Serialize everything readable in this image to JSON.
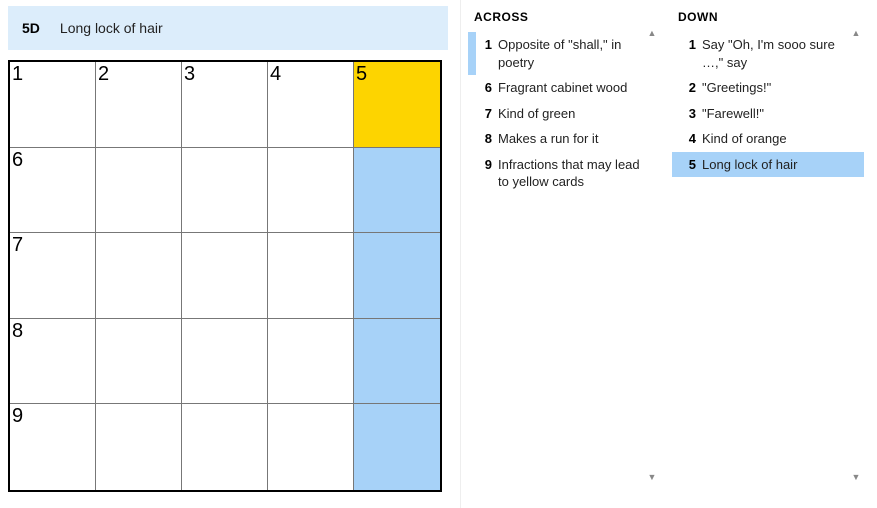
{
  "current_clue": {
    "label": "5D",
    "text": "Long lock of hair"
  },
  "grid": {
    "rows": 5,
    "cols": 5,
    "cells": [
      {
        "n": "1"
      },
      {
        "n": "2"
      },
      {
        "n": "3"
      },
      {
        "n": "4"
      },
      {
        "n": "5",
        "focus": true,
        "hl": true
      },
      {
        "n": "6"
      },
      {},
      {},
      {},
      {
        "hl": true
      },
      {
        "n": "7"
      },
      {},
      {},
      {},
      {
        "hl": true
      },
      {
        "n": "8"
      },
      {},
      {},
      {},
      {
        "hl": true
      },
      {
        "n": "9"
      },
      {},
      {},
      {},
      {
        "hl": true
      }
    ]
  },
  "across": {
    "header": "ACROSS",
    "clues": [
      {
        "n": "1",
        "t": "Opposite of \"shall,\" in poetry",
        "related": true
      },
      {
        "n": "6",
        "t": "Fragrant cabinet wood"
      },
      {
        "n": "7",
        "t": "Kind of green"
      },
      {
        "n": "8",
        "t": "Makes a run for it"
      },
      {
        "n": "9",
        "t": "Infractions that may lead to yellow cards"
      }
    ]
  },
  "down": {
    "header": "DOWN",
    "clues": [
      {
        "n": "1",
        "t": "Say \"Oh, I'm sooo sure …,\" say"
      },
      {
        "n": "2",
        "t": "\"Greetings!\""
      },
      {
        "n": "3",
        "t": "\"Farewell!\""
      },
      {
        "n": "4",
        "t": "Kind of orange"
      },
      {
        "n": "5",
        "t": "Long lock of hair",
        "selected": true
      }
    ]
  },
  "icons": {
    "up": "▲",
    "down": "▼"
  }
}
